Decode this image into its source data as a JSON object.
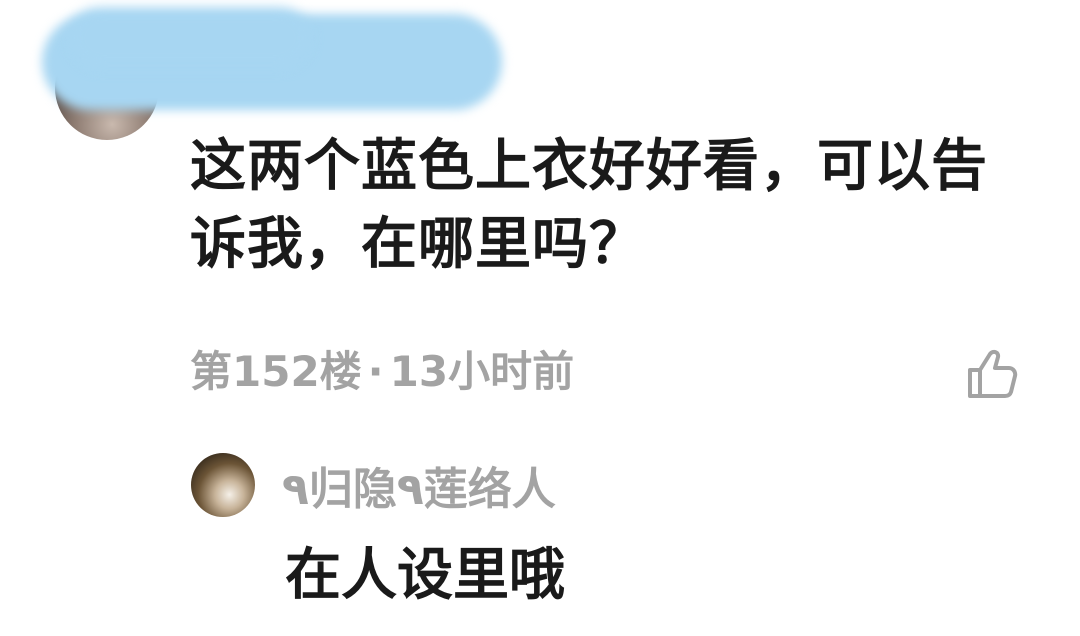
{
  "comment": {
    "author_redacted": true,
    "text": "这两个蓝色上衣好好看，可以告诉我，在哪里吗？",
    "floor": "第152楼",
    "separator": "·",
    "time": "13小时前",
    "like_icon": "thumbs-up-icon"
  },
  "reply": {
    "author": "٩归隐٩莲络人",
    "text": "在人设里哦"
  },
  "colors": {
    "text_primary": "#1a1a1a",
    "text_secondary": "#a3a3a3",
    "redaction": "#a7d6f2"
  }
}
